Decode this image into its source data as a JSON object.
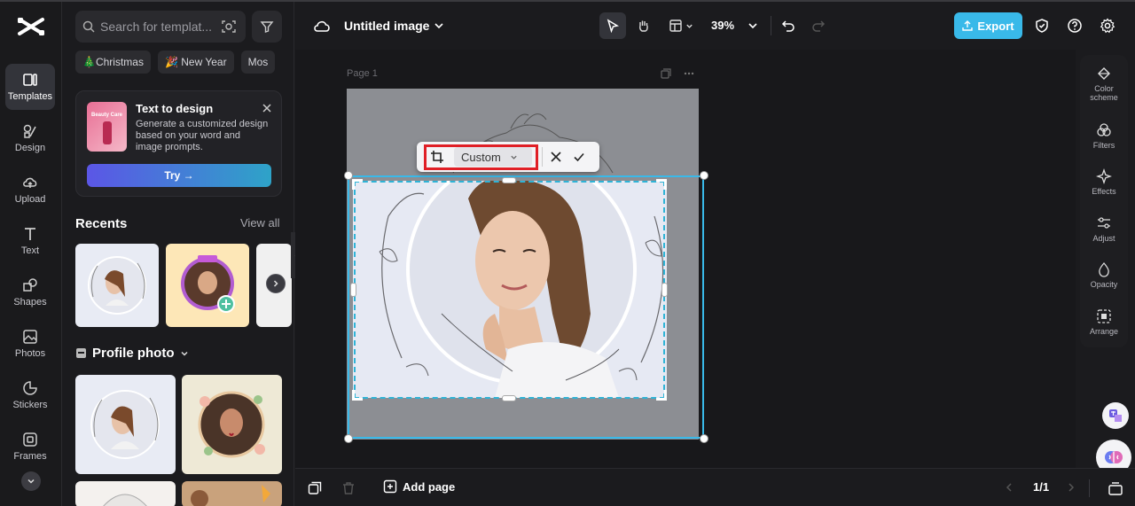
{
  "rail": {
    "items": [
      {
        "label": "Templates",
        "icon": "templates-icon"
      },
      {
        "label": "Design",
        "icon": "design-icon"
      },
      {
        "label": "Upload",
        "icon": "upload-icon"
      },
      {
        "label": "Text",
        "icon": "text-icon"
      },
      {
        "label": "Shapes",
        "icon": "shapes-icon"
      },
      {
        "label": "Photos",
        "icon": "photos-icon"
      },
      {
        "label": "Stickers",
        "icon": "stickers-icon"
      },
      {
        "label": "Frames",
        "icon": "frames-icon"
      }
    ]
  },
  "panel": {
    "search_placeholder": "Search for templat...",
    "chips": [
      "🎄Christmas",
      "🎉 New Year",
      "Mos"
    ],
    "promo": {
      "title": "Text to design",
      "description": "Generate a customized design based on your word and image prompts.",
      "button": "Try →",
      "image_caption": "Beauty Care"
    },
    "recents_title": "Recents",
    "view_all": "View all",
    "profile_title": "Profile photo"
  },
  "toolbar": {
    "doc_title": "Untitled image",
    "zoom": "39%",
    "export": "Export"
  },
  "canvas": {
    "page_label": "Page 1",
    "crop_option": "Custom"
  },
  "props": {
    "items": [
      {
        "label": "Color scheme"
      },
      {
        "label": "Filters"
      },
      {
        "label": "Effects"
      },
      {
        "label": "Adjust"
      },
      {
        "label": "Opacity"
      },
      {
        "label": "Arrange"
      }
    ]
  },
  "bottom": {
    "add_page": "Add page",
    "page_count": "1/1"
  },
  "colors": {
    "accent": "#39b9e9",
    "highlight": "#e01f26",
    "background": "#1b1b1e"
  }
}
